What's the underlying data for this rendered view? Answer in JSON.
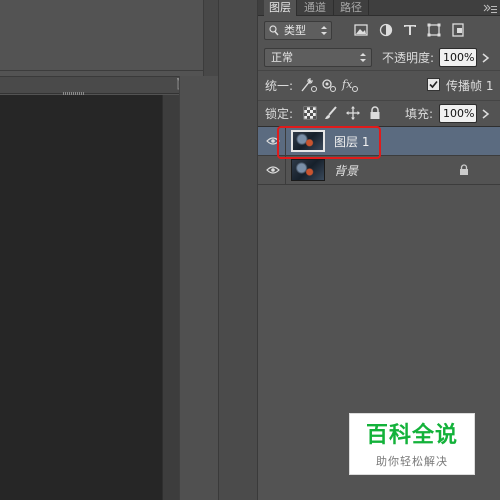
{
  "panel": {
    "tabs": [
      "图层",
      "通道",
      "路径"
    ],
    "filter": {
      "label": "类型"
    },
    "blend_mode": "正常",
    "opacity_label": "不透明度:",
    "opacity_value": "100%",
    "unify_label": "统一:",
    "propagate_label": "传播帧 1",
    "propagate_checked": true,
    "lock_label": "锁定:",
    "fill_label": "填充:",
    "fill_value": "100%"
  },
  "layers": [
    {
      "name": "图层 1",
      "selected": true,
      "visible": true,
      "locked": false
    },
    {
      "name": "背景",
      "selected": false,
      "visible": true,
      "locked": true
    }
  ],
  "icons": {
    "filter_icons": [
      "image-filter-icon",
      "adjustment-filter-icon",
      "type-filter-icon",
      "shape-filter-icon",
      "smart-object-filter-icon"
    ],
    "unify_icons": [
      "unify-position-icon",
      "unify-visibility-icon",
      "unify-style-icon"
    ],
    "lock_icons": [
      "lock-transparent-pixels-icon",
      "lock-image-pixels-icon",
      "lock-position-icon",
      "lock-all-icon"
    ]
  },
  "colors": {
    "selected_row": "#5b6b80",
    "highlight_box": "#e01b1b",
    "watermark_green": "#13b23a"
  },
  "watermark": {
    "title": "百科全说",
    "subtitle": "助你轻松解决"
  }
}
